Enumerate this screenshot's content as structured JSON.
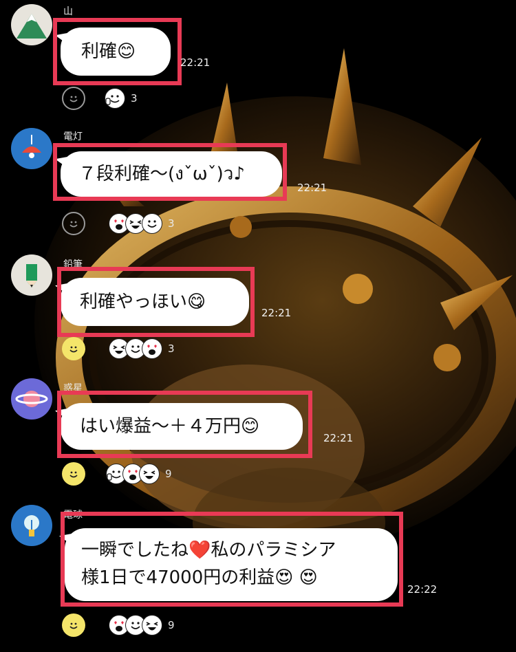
{
  "messages": [
    {
      "sender": "山",
      "avatar": "mountain-avatar",
      "lines": [
        "利確😊"
      ],
      "time": "22:21",
      "reactions": [
        "thumbs-up-face"
      ],
      "reaction_count": "3"
    },
    {
      "sender": "電灯",
      "avatar": "lamp-avatar",
      "lines": [
        "７段利確〜(งˇωˇ)ว♪"
      ],
      "time": "22:21",
      "reactions": [
        "heart-eyes-face",
        "laughing-face",
        "smile-face"
      ],
      "reaction_count": "3"
    },
    {
      "sender": "鉛筆",
      "avatar": "pencil-avatar",
      "lines": [
        "利確やっほい😋"
      ],
      "time": "22:21",
      "reactions": [
        "laughing-face",
        "smile-face",
        "heart-eyes-face"
      ],
      "reaction_count": "3"
    },
    {
      "sender": "惑星",
      "avatar": "planet-avatar",
      "lines": [
        "はい爆益〜＋４万円😊"
      ],
      "time": "22:21",
      "reactions": [
        "thumbs-up-face",
        "heart-eyes-face",
        "laughing-face"
      ],
      "reaction_count": "9"
    },
    {
      "sender": "電球",
      "avatar": "bulb-avatar",
      "lines": [
        "一瞬でしたね❤️私のパラミシア",
        "様1日で47000円の利益😍 😍"
      ],
      "time": "22:22",
      "reactions": [
        "heart-eyes-face",
        "smile-face",
        "laughing-face"
      ],
      "reaction_count": "9"
    }
  ],
  "colors": {
    "highlight": "#e83a55",
    "bubble": "#ffffff",
    "background": "#000000",
    "reaction_filled": "#f4e56a"
  }
}
